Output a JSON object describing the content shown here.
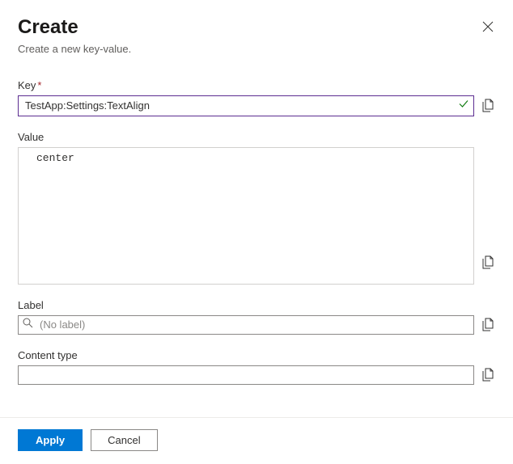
{
  "header": {
    "title": "Create",
    "subtitle": "Create a new key-value."
  },
  "fields": {
    "key": {
      "label": "Key",
      "required_mark": "*",
      "value": "TestApp:Settings:TextAlign"
    },
    "value": {
      "label": "Value",
      "value": "center"
    },
    "label": {
      "label": "Label",
      "placeholder": "(No label)",
      "value": ""
    },
    "content_type": {
      "label": "Content type",
      "value": ""
    }
  },
  "footer": {
    "apply": "Apply",
    "cancel": "Cancel"
  }
}
